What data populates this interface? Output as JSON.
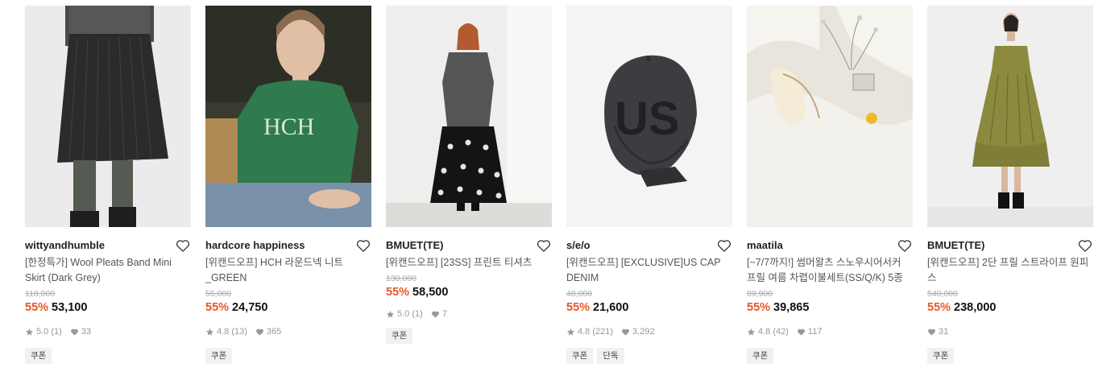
{
  "products": [
    {
      "brand": "wittyandhumble",
      "title": "[한정특가] Wool Pleats Band Mini Skirt (Dark Grey)",
      "original_price": "118,000",
      "discount": "55%",
      "price": "53,100",
      "rating": "5.0",
      "review_count": "(1)",
      "likes": "33",
      "badges": [
        "쿠폰"
      ]
    },
    {
      "brand": "hardcore happiness",
      "title": "[위캔드오프] HCH 라운드넥 니트 _GREEN",
      "original_price": "55,000",
      "discount": "55%",
      "price": "24,750",
      "rating": "4.8",
      "review_count": "(13)",
      "likes": "365",
      "badges": [
        "쿠폰"
      ]
    },
    {
      "brand": "BMUET(TE)",
      "title": "[위캔드오프] [23SS] 프린트 티셔츠",
      "original_price": "130,000",
      "discount": "55%",
      "price": "58,500",
      "rating": "5.0",
      "review_count": "(1)",
      "likes": "7",
      "badges": [
        "쿠폰"
      ]
    },
    {
      "brand": "s/e/o",
      "title": "[위캔드오프] [EXCLUSIVE]US CAP DENIM",
      "original_price": "48,000",
      "discount": "55%",
      "price": "21,600",
      "rating": "4.8",
      "review_count": "(221)",
      "likes": "3,292",
      "badges": [
        "쿠폰",
        "단독"
      ]
    },
    {
      "brand": "maatila",
      "title": "[~7/7까지!] 썸머왈츠 스노우시어서커 프릴 여름 차렵이불세트(SS/Q/K) 5종",
      "original_price": "89,900",
      "discount": "55%",
      "price": "39,865",
      "rating": "4.8",
      "review_count": "(42)",
      "likes": "117",
      "badges": [
        "쿠폰"
      ]
    },
    {
      "brand": "BMUET(TE)",
      "title": "[위캔드오프] 2단 프릴 스트라이프 원피스",
      "original_price": "540,000",
      "discount": "55%",
      "price": "238,000",
      "likes": "31",
      "badges": [
        "쿠폰"
      ]
    }
  ],
  "icons": {
    "heart": "heart-outline-icon",
    "star": "star-icon",
    "like": "heart-filled-icon"
  },
  "colors": {
    "discount": "#e8572a",
    "badge_bg": "#f1f1f1"
  }
}
